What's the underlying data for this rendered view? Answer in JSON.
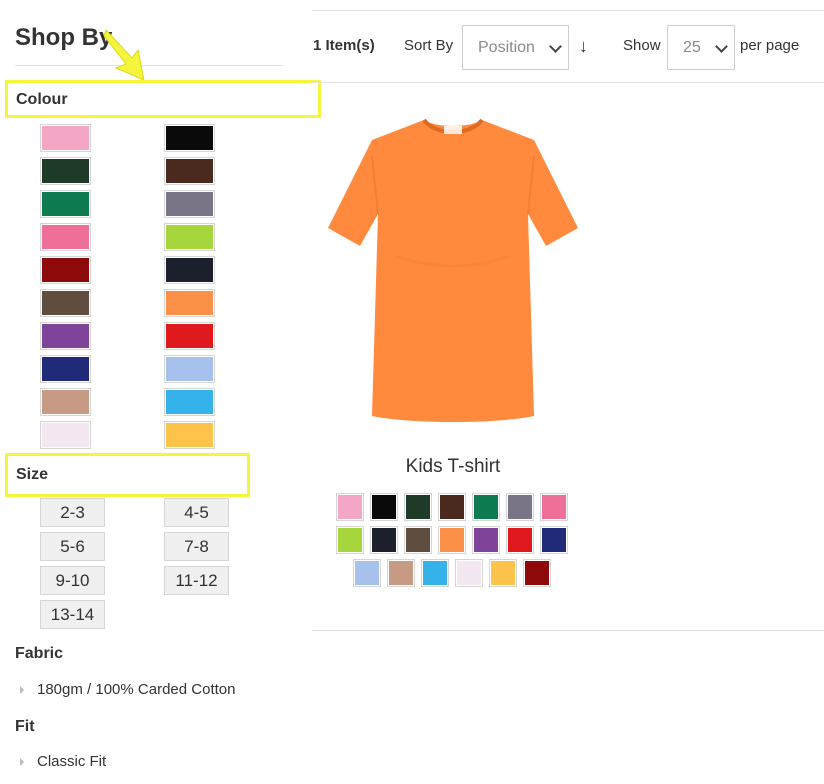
{
  "sidebar": {
    "title": "Shop By",
    "colour_title": "Colour",
    "size_title": "Size",
    "fabric_title": "Fabric",
    "fabric_option": "180gm / 100% Carded Cotton",
    "fit_title": "Fit",
    "fit_option": "Classic Fit",
    "colour_swatches": [
      "#f4a6c7",
      "#0a0a0a",
      "#1e3b2a",
      "#4a2a1e",
      "#0d7a4f",
      "#7a7486",
      "#ee6f98",
      "#a6d63c",
      "#8e0a0a",
      "#1c1f2c",
      "#5f4d3f",
      "#fb9048",
      "#7f439a",
      "#e0191f",
      "#202a78",
      "#a6c2ec",
      "#c79a85",
      "#35b2e9",
      "#f3e8f2",
      "#fec34a"
    ],
    "sizes": [
      "2-3",
      "4-5",
      "5-6",
      "7-8",
      "9-10",
      "11-12",
      "13-14"
    ]
  },
  "toolbar": {
    "item_count": "1 Item(s)",
    "sort_label": "Sort By",
    "sort_value": "Position",
    "sort_direction_icon": "arrow-down-icon",
    "show_label": "Show",
    "limit_value": "25",
    "per_page_label": "per page"
  },
  "product": {
    "name": "Kids T-shirt",
    "image_color": "#ff8a3d",
    "swatch_rows": [
      [
        "#f4a6c7",
        "#0a0a0a",
        "#1e3b2a",
        "#4a2a1e",
        "#0d7a4f",
        "#7a7486",
        "#ee6f98"
      ],
      [
        "#a6d63c",
        "#1c1f2c",
        "#5f4d3f",
        "#fb9048",
        "#7f439a",
        "#e0191f",
        "#202a78"
      ],
      [
        "#a6c2ec",
        "#c79a85",
        "#35b2e9",
        "#f3e8f2",
        "#fec34a",
        "#8e0a0a"
      ]
    ]
  },
  "annotation": {
    "highlight_color": "#f5f53c"
  }
}
